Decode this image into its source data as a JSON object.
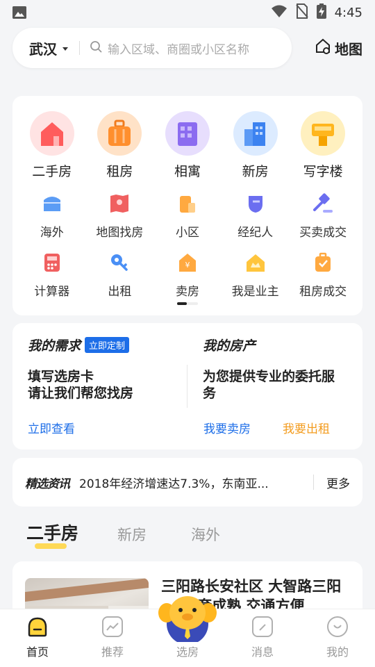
{
  "status_bar": {
    "time": "4:45"
  },
  "search": {
    "city": "武汉",
    "placeholder": "输入区域、商圈或小区名称",
    "map_label": "地图"
  },
  "categories_main": [
    {
      "label": "二手房",
      "icon": "house-icon",
      "color": "#ff6b6b"
    },
    {
      "label": "租房",
      "icon": "suitcase-icon",
      "color": "#ff9a3c"
    },
    {
      "label": "相寓",
      "icon": "building-icon",
      "color": "#8b6cf0"
    },
    {
      "label": "新房",
      "icon": "buildings-icon",
      "color": "#4a8ff5"
    },
    {
      "label": "写字楼",
      "icon": "office-icon",
      "color": "#ffc53d"
    }
  ],
  "categories_sub_row1": [
    {
      "label": "海外",
      "icon": "overseas-icon",
      "color": "#5b9cf5"
    },
    {
      "label": "地图找房",
      "icon": "map-pin-icon",
      "color": "#f06060"
    },
    {
      "label": "小区",
      "icon": "community-icon",
      "color": "#ffa940"
    },
    {
      "label": "经纪人",
      "icon": "agent-icon",
      "color": "#6b6ef0"
    },
    {
      "label": "买卖成交",
      "icon": "gavel-icon",
      "color": "#6b6ef0"
    }
  ],
  "categories_sub_row2": [
    {
      "label": "计算器",
      "icon": "calculator-icon",
      "color": "#f06060"
    },
    {
      "label": "出租",
      "icon": "key-icon",
      "color": "#4a8ff5"
    },
    {
      "label": "卖房",
      "icon": "sell-icon",
      "color": "#ffa940"
    },
    {
      "label": "我是业主",
      "icon": "owner-icon",
      "color": "#ffc53d"
    },
    {
      "label": "租房成交",
      "icon": "rent-deal-icon",
      "color": "#ffa940"
    }
  ],
  "needs": {
    "left_title": "我的需求",
    "left_badge": "立即定制",
    "left_desc_line1": "填写选房卡",
    "left_desc_line2": "请让我们帮您找房",
    "left_link": "立即查看",
    "right_title": "我的房产",
    "right_desc_line1": "为您提供专业的委托服",
    "right_desc_line2": "务",
    "right_link_sell": "我要卖房",
    "right_link_rent": "我要出租"
  },
  "news": {
    "tag": "精选资讯",
    "text": "2018年经济增速达7.3%，东南亚...",
    "more": "更多"
  },
  "tabs": [
    "二手房",
    "新房",
    "海外"
  ],
  "listing": {
    "title": "三阳路长安社区 大智路三阳 ... 配套成熟 交通方便"
  },
  "bottom_nav": [
    {
      "label": "首页",
      "icon": "home-icon"
    },
    {
      "label": "推荐",
      "icon": "recommend-icon"
    },
    {
      "label": "选房",
      "icon": "mascot-icon"
    },
    {
      "label": "消息",
      "icon": "message-icon"
    },
    {
      "label": "我的",
      "icon": "profile-icon"
    }
  ],
  "colors": {
    "accent_blue": "#1d6ee8",
    "accent_orange": "#f39c1f",
    "accent_yellow": "#ffd43b"
  }
}
